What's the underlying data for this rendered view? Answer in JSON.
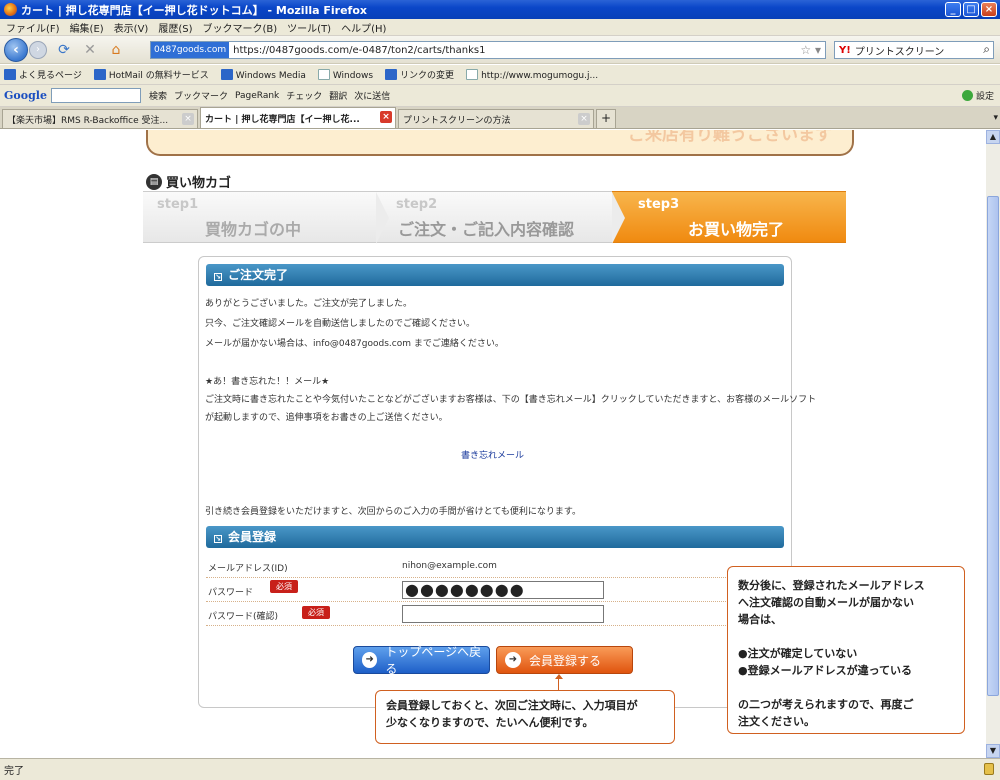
{
  "window": {
    "title": "カート | 押し花専門店【イー押し花ドットコム】 - Mozilla Firefox",
    "buttons": {
      "minimize": "_",
      "maximize": "□",
      "close": "×"
    }
  },
  "menu": [
    "ファイル(F)",
    "編集(E)",
    "表示(V)",
    "履歴(S)",
    "ブックマーク(B)",
    "ツール(T)",
    "ヘルプ(H)"
  ],
  "nav": {
    "site_badge": "0487goods.com",
    "url": "https://0487goods.com/e-0487/ton2/carts/thanks1",
    "search_placeholder": "プリントスクリーン",
    "search_engine": "Y!"
  },
  "bookmarks": [
    "よく見るページ",
    "HotMail の無料サービス",
    "Windows Media",
    "Windows",
    "リンクの変更",
    "http://www.mogumogu.j..."
  ],
  "google_toolbar": {
    "logo": "Google",
    "items": [
      "検索",
      "ブックマーク",
      "PageRank",
      "チェック",
      "翻訳",
      "次に送信"
    ],
    "settings": "設定"
  },
  "tabs": [
    {
      "label": "【楽天市場】RMS R-Backoffice 受注...",
      "active": false
    },
    {
      "label": "カート | 押し花専門店【イー押し花...",
      "active": true
    },
    {
      "label": "プリントスクリーンの方法",
      "active": false
    }
  ],
  "status": "完了",
  "page": {
    "banner_text": "ご来店有り難うございます",
    "cart_title": "買い物カゴ",
    "steps": [
      {
        "no": "step1",
        "name": "買物カゴの中"
      },
      {
        "no": "step2",
        "name": "ご注文・ご記入内容確認"
      },
      {
        "no": "step3",
        "name": "お買い物完了"
      }
    ],
    "order_complete": {
      "heading": "ご注文完了",
      "lines": [
        "ありがとうございました。ご注文が完了しました。",
        "只今、ご注文確認メールを自動送信しましたのでご確認ください。",
        "メールが届かない場合は、info@0487goods.com までご連絡ください。"
      ],
      "forgot_title": "★あ！書き忘れた！！メール★",
      "forgot_lines": [
        "ご注文時に書き忘れたことや今気付いたことなどがございますお客様は、下の【書き忘れメール】クリックしていただきますと、お客様のメールソフト",
        "が起動しますので、追伸事項をお書きの上ご送信ください。"
      ],
      "mail_link": "書き忘れメール",
      "member_hint": "引き続き会員登録をいただけますと、次回からのご入力の手間が省けとても便利になります。"
    },
    "registration": {
      "heading": "会員登録",
      "email_label": "メールアドレス(ID)",
      "email_value": "nihon@example.com",
      "password_label": "パスワード",
      "password_value": "●●●●●●●●",
      "confirm_label": "パスワード(確認)",
      "confirm_value": "",
      "required_badge": "必須",
      "top_button": "トップページへ戻る",
      "register_button": "会員登録する"
    },
    "note_register": [
      "会員登録しておくと、次回ご注文時に、入力項目が",
      "少なくなりますので、たいへん便利です。"
    ],
    "note_mail": [
      "数分後に、登録されたメールアドレス",
      "へ注文確認の自動メールが届かない",
      "場合は、",
      "",
      "●注文が確定していない",
      "●登録メールアドレスが違っている",
      "",
      "の二つが考えられますので、再度ご",
      "注文ください。"
    ]
  }
}
